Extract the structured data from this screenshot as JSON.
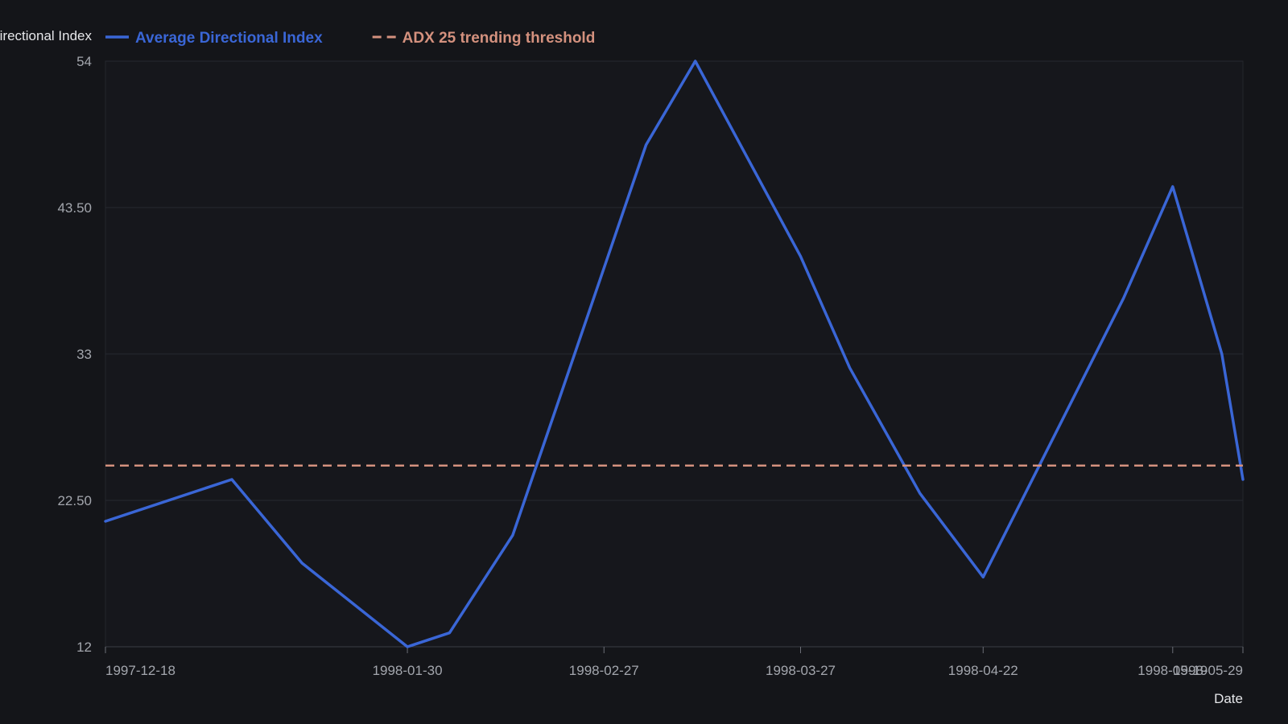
{
  "chart_data": {
    "type": "line",
    "title": "",
    "xlabel": "Date",
    "ylabel": "Average Directional Index",
    "ylim": [
      12,
      54
    ],
    "y_ticks": [
      "12",
      "22.50",
      "33",
      "43.50",
      "54"
    ],
    "x_ticks": [
      "1997-12-18",
      "1998-01-30",
      "1998-02-27",
      "1998-03-27",
      "1998-04-22",
      "1998-05-19",
      "1998-05-29"
    ],
    "grid": true,
    "legend_position": "top-left",
    "series": [
      {
        "name": "Average Directional Index",
        "color": "#3a66d6",
        "style": "solid",
        "x": [
          "1997-12-18",
          "1998-01-05",
          "1998-01-15",
          "1998-01-30",
          "1998-02-05",
          "1998-02-14",
          "1998-03-05",
          "1998-03-12",
          "1998-03-27",
          "1998-04-03",
          "1998-04-13",
          "1998-04-22",
          "1998-04-30",
          "1998-05-12",
          "1998-05-19",
          "1998-05-26",
          "1998-05-29"
        ],
        "values": [
          21,
          24,
          18,
          12,
          13,
          20,
          48,
          54,
          40,
          32,
          23,
          17,
          25,
          37,
          45,
          33,
          24
        ]
      },
      {
        "name": "ADX 25 trending threshold",
        "color": "#d4917e",
        "style": "dashed",
        "x": [
          "1997-12-18",
          "1998-05-29"
        ],
        "values": [
          25,
          25
        ]
      }
    ]
  }
}
